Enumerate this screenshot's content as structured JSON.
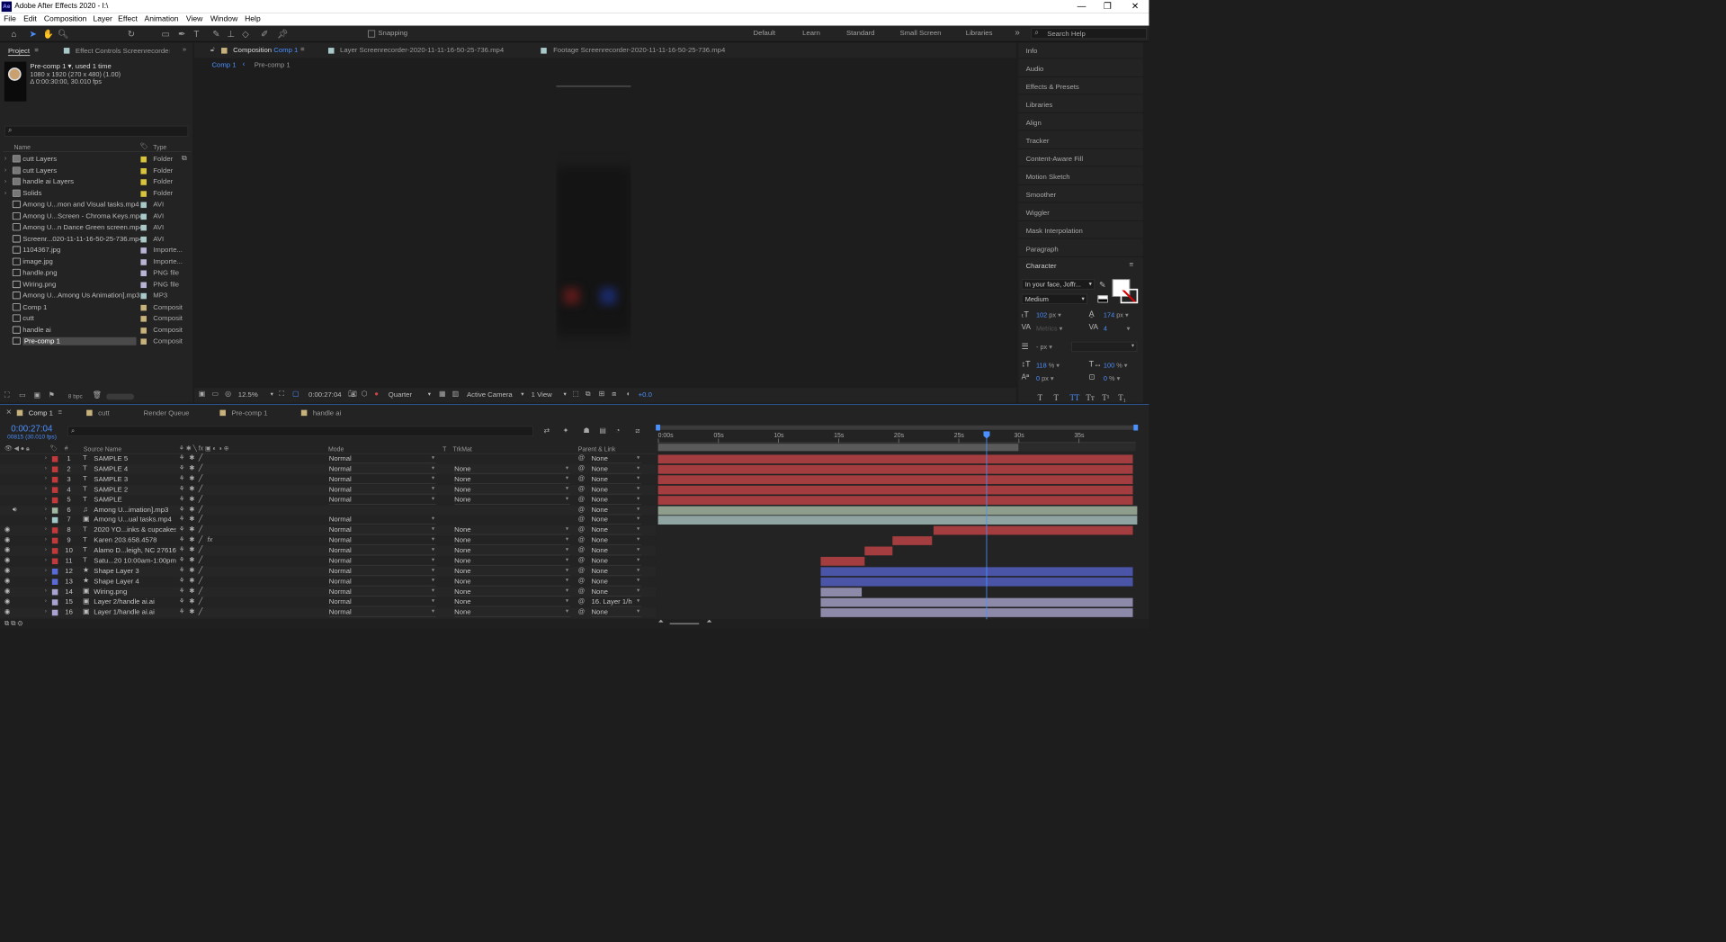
{
  "app": {
    "title": "Adobe After Effects 2020 - I:\\",
    "logo": "Ae"
  },
  "menu": [
    "File",
    "Edit",
    "Composition",
    "Layer",
    "Effect",
    "Animation",
    "View",
    "Window",
    "Help"
  ],
  "toolbar": {
    "snapping": "Snapping",
    "workspaces": [
      "Default",
      "Learn",
      "Standard",
      "Small Screen",
      "Libraries"
    ],
    "search_placeholder": "Search Help"
  },
  "project": {
    "tab": "Project",
    "effect_tab": "Effect Controls Screenrecorder-2",
    "item_name": "Pre-comp 1",
    "item_used": ", used 1 time",
    "item_dims": "1080 x 1920  (270 x 480) (1.00)",
    "item_dur": "Δ 0:00:30:00, 30.010 fps",
    "col_name": "Name",
    "col_type": "Type",
    "bpc": "8 bpc",
    "items": [
      {
        "name": "cutt Layers",
        "type": "Folder",
        "color": "#d8c43a",
        "icon": "folder-icon"
      },
      {
        "name": "cutt Layers",
        "type": "Folder",
        "color": "#d8c43a",
        "icon": "folder-icon"
      },
      {
        "name": "handle ai Layers",
        "type": "Folder",
        "color": "#d8c43a",
        "icon": "folder-icon"
      },
      {
        "name": "Solids",
        "type": "Folder",
        "color": "#d8c43a",
        "icon": "folder-icon"
      },
      {
        "name": "Among U...mon and Visual tasks.mp4",
        "type": "AVI",
        "color": "#a9c9c9",
        "icon": "video-icon"
      },
      {
        "name": "Among U...Screen - Chroma Keys.mp4",
        "type": "AVI",
        "color": "#a9c9c9",
        "icon": "video-icon"
      },
      {
        "name": "Among U...n Dance Green screen.mp4",
        "type": "AVI",
        "color": "#a9c9c9",
        "icon": "video-icon"
      },
      {
        "name": "Screenr...020-11-11-16-50-25-736.mp4",
        "type": "AVI",
        "color": "#a9c9c9",
        "icon": "video-icon"
      },
      {
        "name": "1104367.jpg",
        "type": "Importe...",
        "color": "#b9b4d6",
        "icon": "image-icon"
      },
      {
        "name": "image.jpg",
        "type": "Importe...",
        "color": "#b9b4d6",
        "icon": "image-icon"
      },
      {
        "name": "handle.png",
        "type": "PNG file",
        "color": "#b9b4d6",
        "icon": "image-icon"
      },
      {
        "name": "Wiring.png",
        "type": "PNG file",
        "color": "#b9b4d6",
        "icon": "image-icon"
      },
      {
        "name": "Among U...Among Us Animation].mp3",
        "type": "MP3",
        "color": "#a9c9c9",
        "icon": "audio-icon"
      },
      {
        "name": "Comp 1",
        "type": "Composit",
        "color": "#c8b27c",
        "icon": "comp-icon"
      },
      {
        "name": "cutt",
        "type": "Composit",
        "color": "#c8b27c",
        "icon": "comp-icon"
      },
      {
        "name": "handle ai",
        "type": "Composit",
        "color": "#c8b27c",
        "icon": "comp-icon"
      },
      {
        "name": "Pre-comp 1",
        "type": "Composit",
        "color": "#c8b27c",
        "icon": "comp-icon"
      }
    ]
  },
  "composition": {
    "tab_prefix": "Composition",
    "tab_name": "Comp 1",
    "layer_tab": "Layer Screenrecorder-2020-11-11-16-50-25-736.mp4",
    "footage_tab": "Footage Screenrecorder-2020-11-11-16-50-25-736.mp4",
    "crumbs": [
      "Comp 1",
      "Pre-comp 1"
    ],
    "zoom": "12.5%",
    "time": "0:00:27:04",
    "resolution": "Quarter",
    "camera": "Active Camera",
    "views": "1 View",
    "exposure": "+0.0"
  },
  "right_panels": [
    "Info",
    "Audio",
    "Effects & Presets",
    "Libraries",
    "Align",
    "Tracker",
    "Content-Aware Fill",
    "Motion Sketch",
    "Smoother",
    "Wiggler",
    "Mask Interpolation",
    "Paragraph"
  ],
  "character": {
    "title": "Character",
    "font": "In your face, Joffr...",
    "style": "Medium",
    "size": "102",
    "size_unit": "px",
    "leading": "174",
    "leading_unit": "px",
    "kerning": "Metrics",
    "tracking": "4",
    "stroke": "- px",
    "vscale": "118",
    "vscale_unit": "%",
    "hscale": "100",
    "hscale_unit": "%",
    "baseline": "0",
    "baseline_unit": "px",
    "tsume": "0",
    "tsume_unit": "%",
    "styles": [
      "T",
      "T",
      "TT",
      "Tт",
      "T¹",
      "T₁"
    ]
  },
  "timeline": {
    "tabs": [
      "Comp 1",
      "cutt",
      "Render Queue",
      "Pre-comp 1",
      "handle ai"
    ],
    "timecode": "0:00:27:04",
    "frames": "00815 (30.010 fps)",
    "headers": {
      "source": "Source Name",
      "mode": "Mode",
      "t": "T",
      "trkmat": "TrkMat",
      "parent": "Parent & Link"
    },
    "ruler": [
      "0:00s",
      "05s",
      "10s",
      "15s",
      "20s",
      "25s",
      "30s",
      "35s"
    ],
    "layers": [
      {
        "n": "1",
        "type": "T",
        "name": "SAMPLE 5",
        "color": "#c0393b",
        "mode": "Normal",
        "trk": "",
        "parent": "None",
        "eye": false
      },
      {
        "n": "2",
        "type": "T",
        "name": "SAMPLE 4",
        "color": "#c0393b",
        "mode": "Normal",
        "trk": "None",
        "parent": "None",
        "eye": false
      },
      {
        "n": "3",
        "type": "T",
        "name": "SAMPLE 3",
        "color": "#c0393b",
        "mode": "Normal",
        "trk": "None",
        "parent": "None",
        "eye": false
      },
      {
        "n": "4",
        "type": "T",
        "name": "SAMPLE 2",
        "color": "#c0393b",
        "mode": "Normal",
        "trk": "None",
        "parent": "None",
        "eye": false
      },
      {
        "n": "5",
        "type": "T",
        "name": "SAMPLE",
        "color": "#c0393b",
        "mode": "Normal",
        "trk": "None",
        "parent": "None",
        "eye": false
      },
      {
        "n": "6",
        "type": "♫",
        "name": "Among U...imation].mp3",
        "color": "#9fb8a2",
        "mode": "",
        "trk": "",
        "parent": "None",
        "eye": false
      },
      {
        "n": "7",
        "type": "▣",
        "name": "Among U...ual tasks.mp4",
        "color": "#9fc8c6",
        "mode": "Normal",
        "trk": "",
        "parent": "None",
        "eye": false
      },
      {
        "n": "8",
        "type": "T",
        "name": "2020 YO...inks & cupcakes",
        "color": "#c0393b",
        "mode": "Normal",
        "trk": "None",
        "parent": "None",
        "eye": true
      },
      {
        "n": "9",
        "type": "T",
        "name": " Karen  203.658.4578",
        "color": "#c0393b",
        "mode": "Normal",
        "trk": "None",
        "parent": "None",
        "eye": true
      },
      {
        "n": "10",
        "type": "T",
        "name": "Alamo D...leigh, NC 27616",
        "color": "#c0393b",
        "mode": "Normal",
        "trk": "None",
        "parent": "None",
        "eye": true
      },
      {
        "n": "11",
        "type": "T",
        "name": "  Satu...20  10:00am-1:00pm",
        "color": "#c0393b",
        "mode": "Normal",
        "trk": "None",
        "parent": "None",
        "eye": true
      },
      {
        "n": "12",
        "type": "★",
        "name": "Shape Layer 3",
        "color": "#5a6bd8",
        "mode": "Normal",
        "trk": "None",
        "parent": "None",
        "eye": true
      },
      {
        "n": "13",
        "type": "★",
        "name": "Shape Layer 4",
        "color": "#5a6bd8",
        "mode": "Normal",
        "trk": "None",
        "parent": "None",
        "eye": true
      },
      {
        "n": "14",
        "type": "▣",
        "name": "Wiring.png",
        "color": "#a9a3d2",
        "mode": "Normal",
        "trk": "None",
        "parent": "None",
        "eye": true
      },
      {
        "n": "15",
        "type": "▣",
        "name": "Layer 2/handle ai.ai",
        "color": "#a9a3d2",
        "mode": "Normal",
        "trk": "None",
        "parent": "16. Layer 1/h",
        "eye": true
      },
      {
        "n": "16",
        "type": "▣",
        "name": "Layer 1/handle ai.ai",
        "color": "#a9a3d2",
        "mode": "Normal",
        "trk": "None",
        "parent": "None",
        "eye": true
      }
    ]
  }
}
